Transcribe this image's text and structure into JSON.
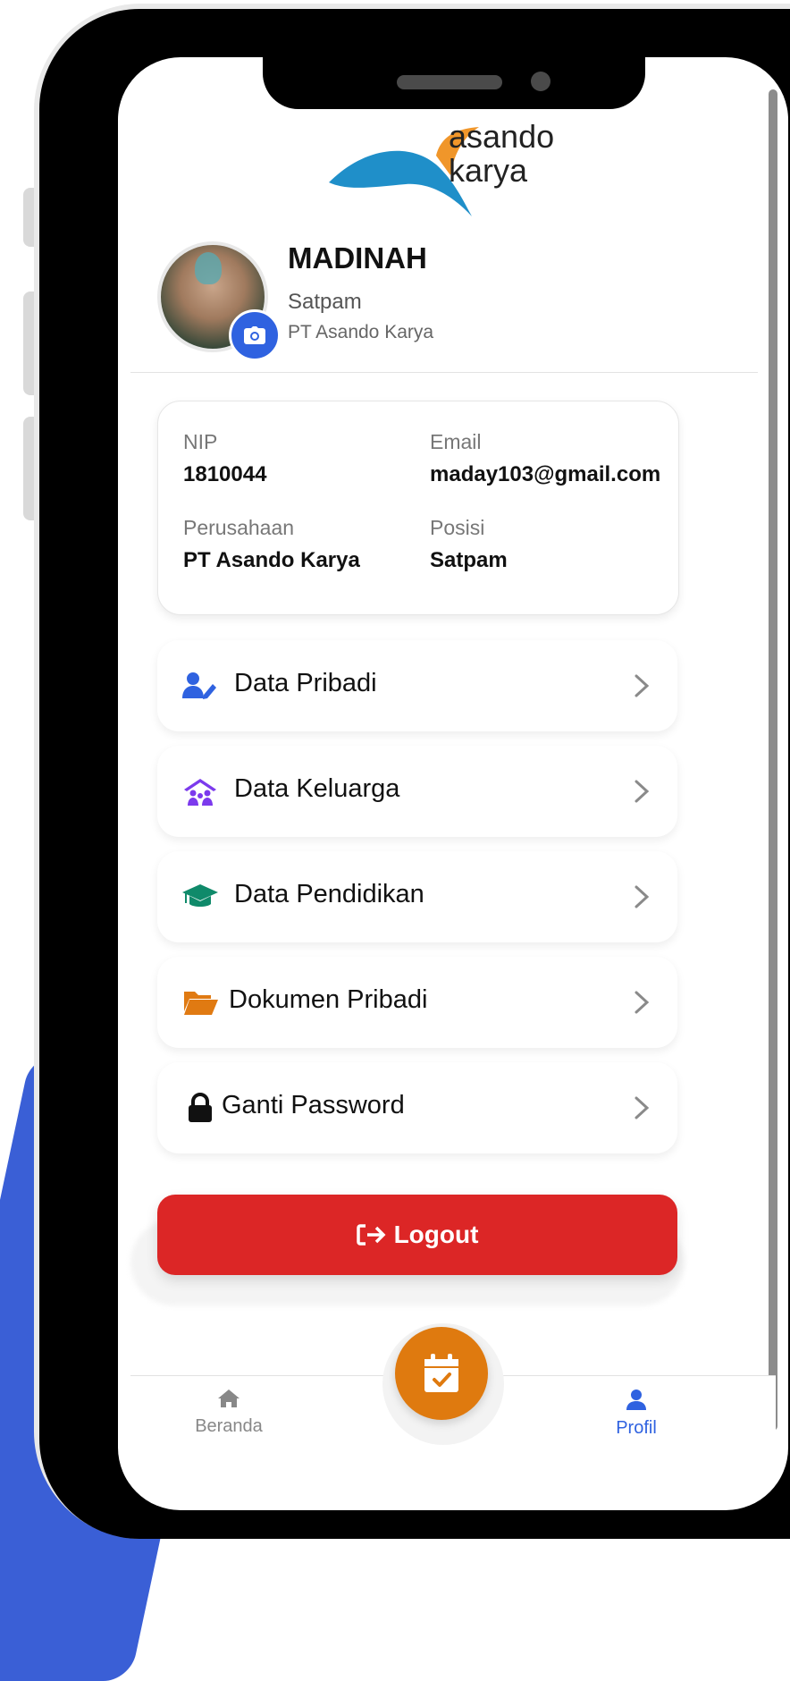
{
  "brand": {
    "logo_line1": "asando",
    "logo_line2": "karya"
  },
  "profile": {
    "name": "MADINAH",
    "role": "Satpam",
    "company": "PT Asando Karya"
  },
  "info": {
    "nip_label": "NIP",
    "nip_value": "1810044",
    "email_label": "Email",
    "email_value": "maday103@gmail.com",
    "company_label": "Perusahaan",
    "company_value": "PT Asando Karya",
    "position_label": "Posisi",
    "position_value": "Satpam"
  },
  "menu": [
    {
      "label": "Data Pribadi",
      "icon": "user-edit-icon",
      "color": "#2f62e0"
    },
    {
      "label": "Data Keluarga",
      "icon": "family-house-icon",
      "color": "#7c3aed"
    },
    {
      "label": "Data Pendidikan",
      "icon": "graduation-cap-icon",
      "color": "#0f8a6a"
    },
    {
      "label": "Dokumen Pribadi",
      "icon": "folder-open-icon",
      "color": "#e07a12"
    },
    {
      "label": "Ganti Password",
      "icon": "lock-icon",
      "color": "#111111"
    }
  ],
  "logout": {
    "label": "Logout",
    "color": "#dc2626"
  },
  "nav": {
    "home_label": "Beranda",
    "profile_label": "Profil",
    "active_color": "#2f62e0",
    "inactive_color": "#888888",
    "fab_color": "#df7a0f"
  }
}
